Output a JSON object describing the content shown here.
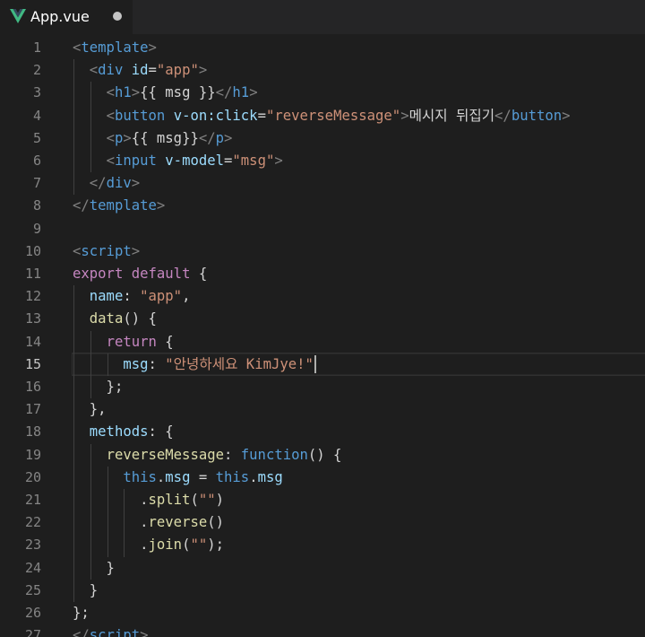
{
  "tab": {
    "title": "App.vue",
    "unsaved": true,
    "icon": "vue-logo-icon"
  },
  "colors": {
    "background": "#1e1e1e",
    "tabbar": "#252526",
    "tag": "#569cd6",
    "attribute": "#9cdcfe",
    "string": "#ce9178",
    "keyword": "#c586c0",
    "function": "#dcdcaa",
    "vue_green": "#41b883"
  },
  "editor": {
    "active_line": 15,
    "lines": [
      {
        "n": "1",
        "tokens": [
          [
            "t-punct",
            "<"
          ],
          [
            "t-tag",
            "template"
          ],
          [
            "t-punct",
            ">"
          ]
        ]
      },
      {
        "n": "2",
        "tokens": [
          [
            "t-plain",
            "  "
          ],
          [
            "t-punct",
            "<"
          ],
          [
            "t-tag",
            "div"
          ],
          [
            "t-plain",
            " "
          ],
          [
            "t-attr",
            "id"
          ],
          [
            "t-plain",
            "="
          ],
          [
            "t-str",
            "\"app\""
          ],
          [
            "t-punct",
            ">"
          ]
        ]
      },
      {
        "n": "3",
        "tokens": [
          [
            "t-plain",
            "    "
          ],
          [
            "t-punct",
            "<"
          ],
          [
            "t-tag",
            "h1"
          ],
          [
            "t-punct",
            ">"
          ],
          [
            "t-text",
            "{{ msg }}"
          ],
          [
            "t-punct",
            "</"
          ],
          [
            "t-tag",
            "h1"
          ],
          [
            "t-punct",
            ">"
          ]
        ]
      },
      {
        "n": "4",
        "tokens": [
          [
            "t-plain",
            "    "
          ],
          [
            "t-punct",
            "<"
          ],
          [
            "t-tag",
            "button"
          ],
          [
            "t-plain",
            " "
          ],
          [
            "t-attr",
            "v-on:click"
          ],
          [
            "t-plain",
            "="
          ],
          [
            "t-str",
            "\"reverseMessage\""
          ],
          [
            "t-punct",
            ">"
          ],
          [
            "t-text",
            "메시지 뒤집기"
          ],
          [
            "t-punct",
            "</"
          ],
          [
            "t-tag",
            "button"
          ],
          [
            "t-punct",
            ">"
          ]
        ]
      },
      {
        "n": "5",
        "tokens": [
          [
            "t-plain",
            "    "
          ],
          [
            "t-punct",
            "<"
          ],
          [
            "t-tag",
            "p"
          ],
          [
            "t-punct",
            ">"
          ],
          [
            "t-text",
            "{{ msg}}"
          ],
          [
            "t-punct",
            "</"
          ],
          [
            "t-tag",
            "p"
          ],
          [
            "t-punct",
            ">"
          ]
        ]
      },
      {
        "n": "6",
        "tokens": [
          [
            "t-plain",
            "    "
          ],
          [
            "t-punct",
            "<"
          ],
          [
            "t-tag",
            "input"
          ],
          [
            "t-plain",
            " "
          ],
          [
            "t-attr",
            "v-model"
          ],
          [
            "t-plain",
            "="
          ],
          [
            "t-str",
            "\"msg\""
          ],
          [
            "t-punct",
            ">"
          ]
        ]
      },
      {
        "n": "7",
        "tokens": [
          [
            "t-plain",
            "  "
          ],
          [
            "t-punct",
            "</"
          ],
          [
            "t-tag",
            "div"
          ],
          [
            "t-punct",
            ">"
          ]
        ]
      },
      {
        "n": "8",
        "tokens": [
          [
            "t-punct",
            "</"
          ],
          [
            "t-tag",
            "template"
          ],
          [
            "t-punct",
            ">"
          ]
        ]
      },
      {
        "n": "9",
        "tokens": []
      },
      {
        "n": "10",
        "tokens": [
          [
            "t-punct",
            "<"
          ],
          [
            "t-tag",
            "script"
          ],
          [
            "t-punct",
            ">"
          ]
        ]
      },
      {
        "n": "11",
        "tokens": [
          [
            "t-kw",
            "export"
          ],
          [
            "t-plain",
            " "
          ],
          [
            "t-kw",
            "default"
          ],
          [
            "t-plain",
            " {"
          ]
        ]
      },
      {
        "n": "12",
        "tokens": [
          [
            "t-plain",
            "  "
          ],
          [
            "t-prop",
            "name"
          ],
          [
            "t-plain",
            ": "
          ],
          [
            "t-str",
            "\"app\""
          ],
          [
            "t-plain",
            ","
          ]
        ]
      },
      {
        "n": "13",
        "tokens": [
          [
            "t-plain",
            "  "
          ],
          [
            "t-fn",
            "data"
          ],
          [
            "t-plain",
            "() {"
          ]
        ]
      },
      {
        "n": "14",
        "tokens": [
          [
            "t-plain",
            "    "
          ],
          [
            "t-kw",
            "return"
          ],
          [
            "t-plain",
            " {"
          ]
        ]
      },
      {
        "n": "15",
        "tokens": [
          [
            "t-plain",
            "      "
          ],
          [
            "t-prop",
            "msg"
          ],
          [
            "t-plain",
            ": "
          ],
          [
            "t-str",
            "\"안녕하세요 KimJye!\""
          ]
        ]
      },
      {
        "n": "16",
        "tokens": [
          [
            "t-plain",
            "    };"
          ]
        ]
      },
      {
        "n": "17",
        "tokens": [
          [
            "t-plain",
            "  },"
          ]
        ]
      },
      {
        "n": "18",
        "tokens": [
          [
            "t-plain",
            "  "
          ],
          [
            "t-prop",
            "methods"
          ],
          [
            "t-plain",
            ": {"
          ]
        ]
      },
      {
        "n": "19",
        "tokens": [
          [
            "t-plain",
            "    "
          ],
          [
            "t-fn",
            "reverseMessage"
          ],
          [
            "t-plain",
            ": "
          ],
          [
            "t-blue",
            "function"
          ],
          [
            "t-plain",
            "() {"
          ]
        ]
      },
      {
        "n": "20",
        "tokens": [
          [
            "t-plain",
            "      "
          ],
          [
            "t-blue",
            "this"
          ],
          [
            "t-plain",
            "."
          ],
          [
            "t-prop",
            "msg"
          ],
          [
            "t-plain",
            " = "
          ],
          [
            "t-blue",
            "this"
          ],
          [
            "t-plain",
            "."
          ],
          [
            "t-prop",
            "msg"
          ]
        ]
      },
      {
        "n": "21",
        "tokens": [
          [
            "t-plain",
            "        ."
          ],
          [
            "t-fn",
            "split"
          ],
          [
            "t-plain",
            "("
          ],
          [
            "t-str",
            "\"\""
          ],
          [
            "t-plain",
            ")"
          ]
        ]
      },
      {
        "n": "22",
        "tokens": [
          [
            "t-plain",
            "        ."
          ],
          [
            "t-fn",
            "reverse"
          ],
          [
            "t-plain",
            "()"
          ]
        ]
      },
      {
        "n": "23",
        "tokens": [
          [
            "t-plain",
            "        ."
          ],
          [
            "t-fn",
            "join"
          ],
          [
            "t-plain",
            "("
          ],
          [
            "t-str",
            "\"\""
          ],
          [
            "t-plain",
            ");"
          ]
        ]
      },
      {
        "n": "24",
        "tokens": [
          [
            "t-plain",
            "    }"
          ]
        ]
      },
      {
        "n": "25",
        "tokens": [
          [
            "t-plain",
            "  }"
          ]
        ]
      },
      {
        "n": "26",
        "tokens": [
          [
            "t-plain",
            "};"
          ]
        ]
      },
      {
        "n": "27",
        "tokens": [
          [
            "t-punct",
            "</"
          ],
          [
            "t-tag",
            "script"
          ],
          [
            "t-punct",
            ">"
          ]
        ]
      }
    ]
  }
}
